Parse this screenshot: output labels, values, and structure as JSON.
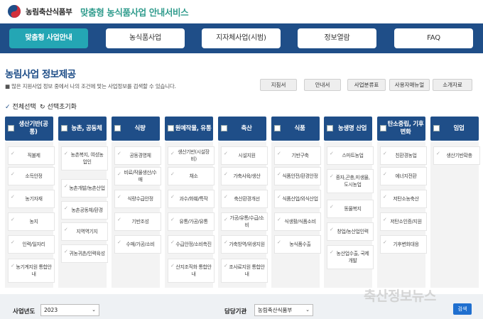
{
  "header": {
    "org_name": "농림축산식품부",
    "service_name": "맞춤형 농식품사업 안내서비스"
  },
  "nav": {
    "items": [
      "맞춤형 사업안내",
      "농식품사업",
      "지자체사업(시범)",
      "정보열람",
      "FAQ"
    ],
    "active": 0
  },
  "page": {
    "title": "농림사업 정보제공",
    "description": "많은 지원사업 정보 중에서 나의 조건에 맞는 사업정보를 검색할 수 있습니다.",
    "doc_buttons": [
      "지침서",
      "안내서",
      "사업분류표",
      "사용자매뉴얼",
      "소개자료"
    ],
    "select_all": "전체선택",
    "reset": "선택초기화"
  },
  "categories": [
    {
      "label": "생산기반(공통)",
      "items": [
        "직불제",
        "소득안정",
        "농기자재",
        "농지",
        "인력/일자리",
        "농기계지원 통합안내"
      ]
    },
    {
      "label": "농촌, 공동체",
      "items": [
        "농촌복지, 여성농업인",
        "농촌개발/농촌산업",
        "농촌공동체/환경",
        "지역역기지",
        "귀농귀촌/인력육성"
      ]
    },
    {
      "label": "식량",
      "items": [
        "공동경영체",
        "비료/작물생산/수매",
        "식량수급안정",
        "기반조성",
        "수매/가공/소비"
      ]
    },
    {
      "label": "원예작물, 유통",
      "items": [
        "생산기반(시설장비)",
        "채소",
        "과수/화훼/특작",
        "유통/가공/유통",
        "수급안정/소비촉진",
        "산지조직화 통합안내"
      ]
    },
    {
      "label": "축산",
      "items": [
        "시설지원",
        "가축사육/생산",
        "축산환경개선",
        "가공/유통/수급/소비",
        "가축방역/위생지원",
        "조사료지원 통합안내"
      ]
    },
    {
      "label": "식품",
      "items": [
        "기반구축",
        "식품안전/환경안정",
        "식품산업/외식산업",
        "식생활/식품소비",
        "농식품수출"
      ]
    },
    {
      "label": "농생명 산업",
      "items": [
        "스마트농업",
        "종자,곤충,미생물, 도시농업",
        "동물복지",
        "창업/농산업인력",
        "농산업수출, 국제개발"
      ]
    },
    {
      "label": "탄소중립, 기후변화",
      "items": [
        "친환경농업",
        "에너지전환",
        "저탄소농축산",
        "저탄소인증/지원",
        "기후변화대응"
      ]
    },
    {
      "label": "임업",
      "items": [
        "생산기반확충"
      ]
    }
  ],
  "search": {
    "year_label": "사업년도",
    "year_value": "2023",
    "agency_label": "담당기관",
    "agency_value": "농림축산식품부",
    "button": "검색"
  },
  "watermark": "축산정보뉴스",
  "colors": {
    "nav_bg": "#1f4e88",
    "active_tab": "#24a6b4",
    "service_title": "#2f9b8c",
    "search_button": "#1f6fcf"
  }
}
